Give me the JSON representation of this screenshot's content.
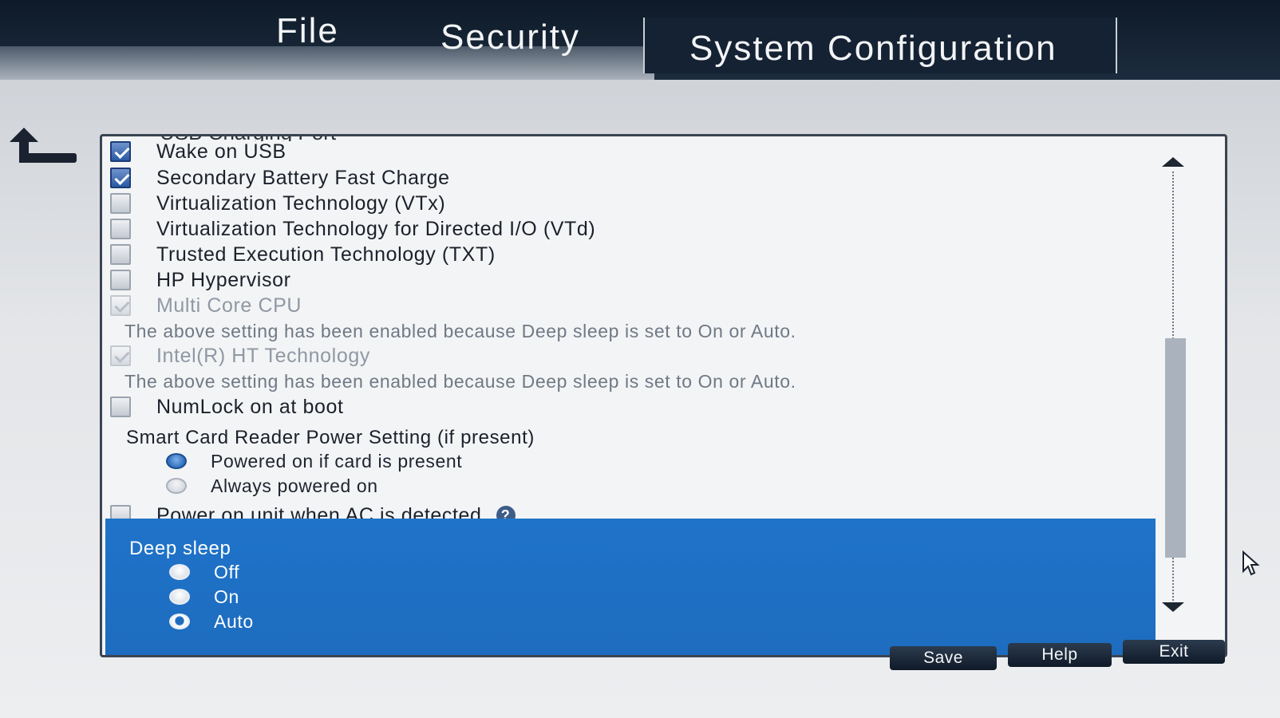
{
  "menu": {
    "items": [
      "File",
      "Security",
      "System Configuration"
    ],
    "active": "System Configuration"
  },
  "settings": {
    "clipped_top_label": "USB Charging Port",
    "checkboxes": [
      {
        "label": "Wake on USB",
        "checked": true,
        "enabled": true
      },
      {
        "label": "Secondary Battery Fast Charge",
        "checked": true,
        "enabled": true
      },
      {
        "label": "Virtualization Technology (VTx)",
        "checked": false,
        "enabled": true
      },
      {
        "label": "Virtualization Technology for Directed I/O (VTd)",
        "checked": false,
        "enabled": true
      },
      {
        "label": "Trusted Execution Technology (TXT)",
        "checked": false,
        "enabled": true
      },
      {
        "label": "HP Hypervisor",
        "checked": false,
        "enabled": true
      },
      {
        "label": "Multi Core CPU",
        "checked": true,
        "enabled": false
      },
      {
        "label": "Intel(R) HT Technology",
        "checked": true,
        "enabled": false
      },
      {
        "label": "NumLock on at boot",
        "checked": false,
        "enabled": true
      },
      {
        "label": "Power on unit when AC is detected",
        "checked": false,
        "enabled": true
      }
    ],
    "notes": [
      "The above setting has been enabled because Deep sleep is set to On or Auto.",
      "The above setting has been enabled because Deep sleep is set to On or Auto."
    ],
    "smart_card": {
      "title": "Smart Card Reader Power Setting (if present)",
      "options": [
        "Powered on if card is present",
        "Always powered on"
      ],
      "selected": "Powered on if card is present"
    },
    "deep_sleep": {
      "title": "Deep sleep",
      "options": [
        "Off",
        "On",
        "Auto"
      ],
      "selected": "Auto"
    }
  },
  "buttons": {
    "save": "Save",
    "help": "Help",
    "exit": "Exit"
  },
  "colors": {
    "topbar": "#0e1a28",
    "highlight": "#1f73c9",
    "button": "#1c2838"
  },
  "icons": [
    "back-arrow-icon",
    "help-icon",
    "scroll-up-icon",
    "scroll-down-icon",
    "mouse-pointer-icon"
  ]
}
